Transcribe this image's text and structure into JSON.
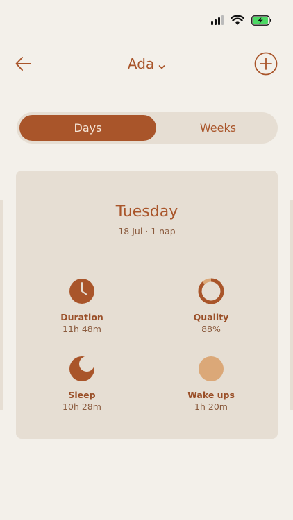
{
  "header": {
    "title": "Ada"
  },
  "segment": {
    "days_label": "Days",
    "weeks_label": "Weeks",
    "active": "Days"
  },
  "card": {
    "day": "Tuesday",
    "subtitle": "18 Jul · 1 nap",
    "stats": {
      "duration": {
        "label": "Duration",
        "value": "11h 48m"
      },
      "quality": {
        "label": "Quality",
        "value": "88%",
        "fraction": 0.88
      },
      "sleep": {
        "label": "Sleep",
        "value": "10h 28m"
      },
      "wake": {
        "label": "Wake ups",
        "value": "1h 20m"
      }
    }
  },
  "colors": {
    "accent": "#a9552a",
    "background": "#f3f0ea",
    "card": "#e6ded3",
    "wake_fill": "#dba878",
    "battery": "#4cd964"
  },
  "icons": {
    "back": "arrow-left-icon",
    "dropdown": "chevron-down-icon",
    "add": "plus-circle-icon",
    "duration": "clock-icon",
    "quality": "ring-icon",
    "sleep": "moon-icon",
    "wake": "circle-icon"
  }
}
